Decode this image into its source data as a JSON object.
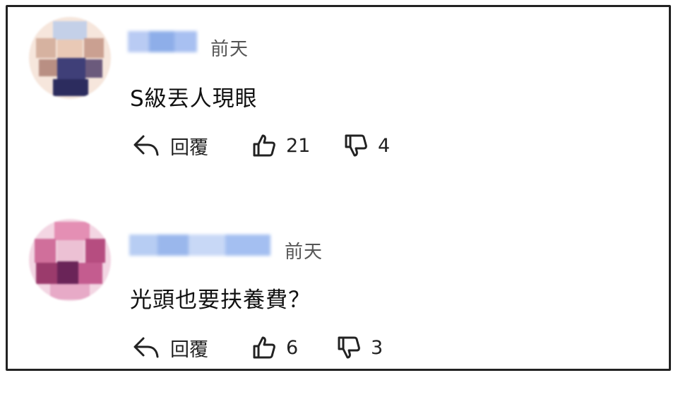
{
  "comments": [
    {
      "time": "前天",
      "text": "S級丟人現眼",
      "reply_label": "回覆",
      "likes": "21",
      "dislikes": "4",
      "avatar_colors": [
        "#f4d9c9",
        "#c9a394",
        "#3a3b6e",
        "#e7c2b0"
      ],
      "name_color": "#9fb8ee"
    },
    {
      "time": "前天",
      "text": "光頭也要扶養費？",
      "reply_label": "回覆",
      "likes": "6",
      "dislikes": "3",
      "avatar_colors": [
        "#d77aa2",
        "#8a2e5f",
        "#efc0d6",
        "#5b1d4a"
      ],
      "name_color": "#a9c3f0"
    }
  ],
  "icons": {
    "reply": "reply-arrow-icon",
    "like": "thumbs-up-icon",
    "dislike": "thumbs-down-icon"
  }
}
